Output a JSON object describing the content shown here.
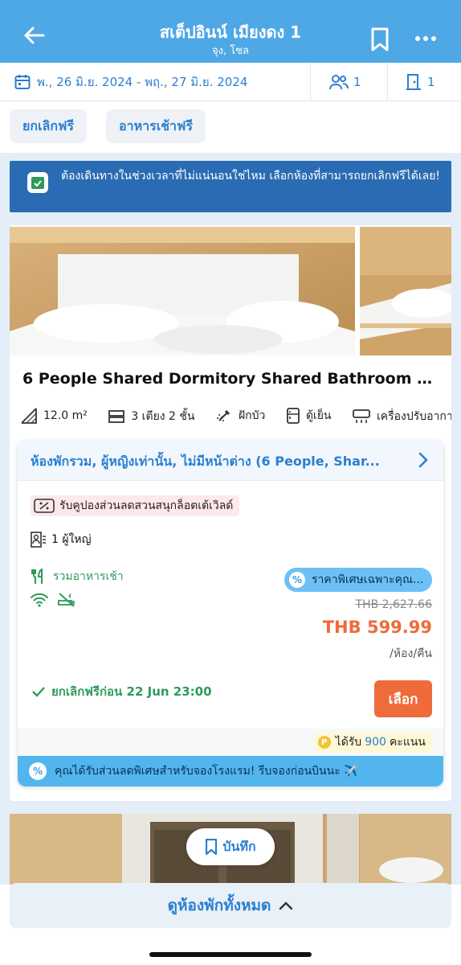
{
  "header": {
    "title": "สเต็ปอินน์ เมียงดง 1",
    "subtitle": "จุง, โซล",
    "bg_color": "#4fa8e6"
  },
  "datebar": {
    "dates": "พ., 26 มิ.ย. 2024 - พฤ., 27 มิ.ย. 2024",
    "guests": "1",
    "rooms": "1"
  },
  "filters": [
    "ยกเลิกฟรี",
    "อาหารเช้าฟรี"
  ],
  "notice": {
    "text": "ต้องเดินทางในช่วงเวลาที่ไม่แน่นอนใช่ไหม เลือกห้องที่สามารถยกเลิกฟรีได้เลย!"
  },
  "room": {
    "title": "6 People Shared Dormitory Shared Bathroom Outs...",
    "amenities": [
      {
        "icon": "area-icon",
        "label": "12.0 m²"
      },
      {
        "icon": "bed-icon",
        "label": "3 เตียง 2 ชั้น"
      },
      {
        "icon": "shower-icon",
        "label": "ฝักบัว"
      },
      {
        "icon": "fridge-icon",
        "label": "ตู้เย็น"
      },
      {
        "icon": "air-conditioner-icon",
        "label": "เครื่องปรับอากาศ"
      }
    ]
  },
  "offer": {
    "heading": "ห้องพักรวม, ผู้หญิงเท่านั้น, ไม่มีหน้าต่าง (6 People, Shar...",
    "coupon": "รับคูปองส่วนลดสวนสนุกล็อตเต้เวิลด์",
    "adults": "1 ผู้ใหญ่",
    "breakfast": "รวมอาหารเช้า",
    "promo": "ราคาพิเศษเฉพาะคุณ...",
    "old_price": "THB 2,627.66",
    "price": "THB 599.99",
    "per_night": "/ห้อง/คืน",
    "cancel": "ยกเลิกฟรีก่อน 22 Jun 23:00",
    "select": "เลือก",
    "points_prefix": "ได้รับ",
    "points_value": "900",
    "points_suffix": "คะแนน",
    "banner": "คุณได้รับส่วนลดพิเศษสำหรับจองโรงแรม! รีบจองก่อนบินนะ ✈️"
  },
  "save_button": "บันทึก",
  "view_all": "ดูห้องพักทั้งหมด",
  "colors": {
    "accent": "#2b7fd1",
    "price": "#ef6b3a",
    "green": "#2e9b5a",
    "notice_bg": "#2a6cb3"
  }
}
